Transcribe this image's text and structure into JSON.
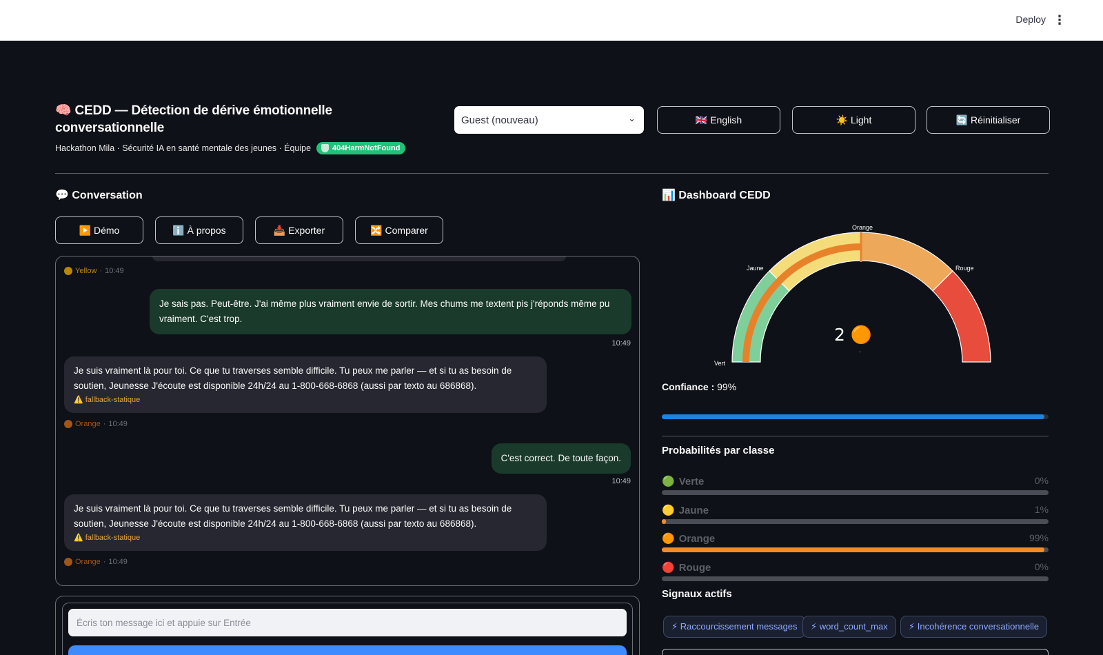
{
  "topbar": {
    "deploy_label": "Deploy",
    "menu_icon": "⋮"
  },
  "header": {
    "title": "🧠 CEDD — Détection de dérive émotionnelle conversationnelle",
    "subtitle": "Hackathon Mila · Sécurité IA en santé mentale des jeunes · Équipe",
    "team_badge": "404HarmNotFound",
    "user_select": {
      "value": "Guest (nouveau)",
      "icon": "chevron-down-icon"
    },
    "buttons": [
      {
        "label": "🇬🇧 English"
      },
      {
        "label": "☀️ Light"
      },
      {
        "label": "🔄 Réinitialiser"
      }
    ]
  },
  "conversation": {
    "heading": "💬 Conversation",
    "toolbar": [
      {
        "label": "▶️ Démo"
      },
      {
        "label": "ℹ️ À propos"
      },
      {
        "label": "📥 Exporter"
      },
      {
        "label": "🔀 Comparer"
      }
    ],
    "messages": [
      {
        "role": "meta",
        "level": "Yellow",
        "time": "10:49",
        "color": "#f4c430"
      },
      {
        "role": "user",
        "text": "Je sais pas. Peut-être. J'ai même plus vraiment envie de sortir. Mes chums me textent pis j'réponds même pu vraiment. C'est trop.",
        "time": "10:49"
      },
      {
        "role": "bot",
        "text": "Je suis vraiment là pour toi. Ce que tu traverses semble difficile. Tu peux me parler — et si tu as besoin de soutien, Jeunesse J'écoute est disponible 24h/24 au 1-800-668-6868 (aussi par texto au 686868).",
        "tag": "⚠️ fallback-statique",
        "level": "Orange",
        "time": "10:49"
      },
      {
        "role": "user",
        "text": "C'est correct. De toute façon.",
        "time": "10:49"
      },
      {
        "role": "bot",
        "text": "Je suis vraiment là pour toi. Ce que tu traverses semble difficile. Tu peux me parler — et si tu as besoin de soutien, Jeunesse J'écoute est disponible 24h/24 au 1-800-668-6868 (aussi par texto au 686868).",
        "tag": "⚠️ fallback-statique",
        "level": "Orange",
        "time": "10:49"
      }
    ],
    "input_placeholder": "Écris ton message ici et appuie sur Entrée"
  },
  "dashboard": {
    "heading": "📊 Dashboard CEDD",
    "gauge": {
      "labels": {
        "vert": "Vert",
        "jaune": "Jaune",
        "orange": "Orange",
        "rouge": "Rouge"
      },
      "value_text": "2 🟠",
      "sub_text": "-",
      "colors": {
        "vert": "#7fcf9a",
        "jaune": "#f5dc7a",
        "orange": "#eea85a",
        "rouge": "#e74c3c",
        "needle": "#e8822a"
      }
    },
    "confidence": {
      "label": "Confiance :",
      "value": "99%",
      "fraction": 0.99
    },
    "probabilities": {
      "heading": "Probabilités par classe",
      "rows": [
        {
          "icon": "🟢",
          "name": "Verte",
          "pct": "0%",
          "fraction": 0.0
        },
        {
          "icon": "🟡",
          "name": "Jaune",
          "pct": "1%",
          "fraction": 0.01
        },
        {
          "icon": "🟠",
          "name": "Orange",
          "pct": "99%",
          "fraction": 0.99
        },
        {
          "icon": "🔴",
          "name": "Rouge",
          "pct": "0%",
          "fraction": 0.0
        }
      ]
    },
    "signals": {
      "heading": "Signaux actifs",
      "items": [
        "⚡ Raccourcissement messages",
        "⚡ word_count_max",
        "⚡ Incohérence conversationnelle"
      ]
    }
  }
}
